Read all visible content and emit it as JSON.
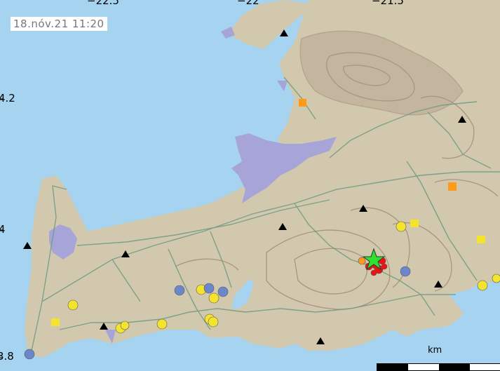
{
  "map": {
    "timestamp": "18.nóv.21  11:20",
    "longitude_labels": [
      "−22.5",
      "−22",
      "−21.5"
    ],
    "latitude_labels": [
      "4.2",
      "4",
      "3.8"
    ],
    "scale_unit": "km"
  },
  "colors": {
    "sea": "#a6d4f0",
    "land": "#d2c8ae",
    "terrain": "#aa9580",
    "roads": "#6f9b82",
    "urban": "#a7a4d8",
    "quake_recent": "#ee1111",
    "quake_hours": "#ff9a1a",
    "quake_day": "#f5e42e",
    "quake_older": "#6b86c9",
    "mainshock_star": "#2ee22e",
    "station": "#000000"
  },
  "legend_symbols": {
    "station": "black triangle",
    "mainshock": "green star",
    "earthquake": "colored circle"
  }
}
